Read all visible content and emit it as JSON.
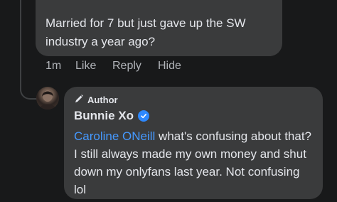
{
  "parent_comment": {
    "text": "Married for 7 but just gave up the SW industry a year ago?",
    "time": "1m",
    "like_label": "Like",
    "reply_label": "Reply",
    "hide_label": "Hide"
  },
  "reply_comment": {
    "badge_label": "Author",
    "badge_icon": "pencil-icon",
    "author_name": "Bunnie Xo",
    "verified_icon": "verified-badge-icon",
    "mention": "Caroline ONeill",
    "text": " what's confusing about that? I still always made my own money and shut down my onlyfans last year. Not confusing lol"
  },
  "colors": {
    "background": "#18191a",
    "bubble": "#3a3b3c",
    "mention": "#4599ff",
    "verified": "#2d88ff",
    "secondary_text": "#b0b3b8"
  }
}
